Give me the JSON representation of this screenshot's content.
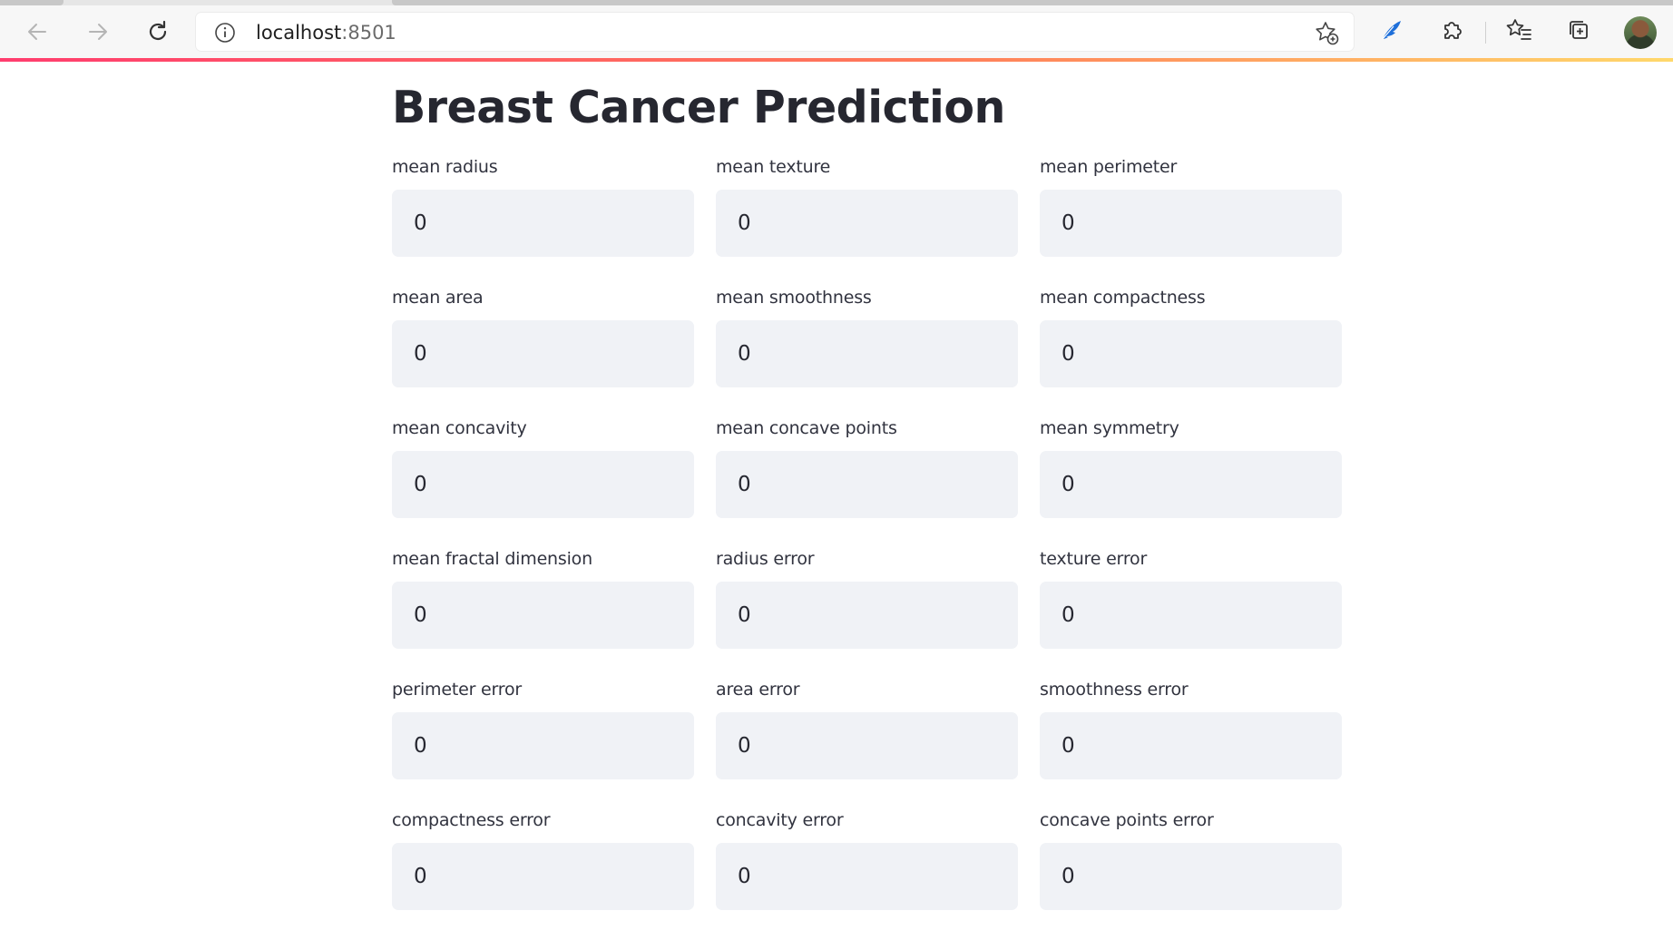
{
  "browser": {
    "url_host": "localhost",
    "url_port": ":8501",
    "icons": {
      "back": "arrow-left-icon",
      "forward": "arrow-right-icon",
      "reload": "reload-icon",
      "site_info": "info-icon",
      "add_favorite": "star-add-icon",
      "extension_1": "feather-extension-icon",
      "extensions": "puzzle-icon",
      "favorites": "favorites-list-icon",
      "collections": "collections-icon",
      "profile": "avatar"
    },
    "accent_gradient": [
      "#ff3d6e",
      "#ff7a59",
      "#ffd86b"
    ]
  },
  "app": {
    "title": "Breast Cancer Prediction",
    "fields": [
      {
        "label": "mean radius",
        "value": "0"
      },
      {
        "label": "mean texture",
        "value": "0"
      },
      {
        "label": "mean perimeter",
        "value": "0"
      },
      {
        "label": "mean area",
        "value": "0"
      },
      {
        "label": "mean smoothness",
        "value": "0"
      },
      {
        "label": "mean compactness",
        "value": "0"
      },
      {
        "label": "mean concavity",
        "value": "0"
      },
      {
        "label": "mean concave points",
        "value": "0"
      },
      {
        "label": "mean symmetry",
        "value": "0"
      },
      {
        "label": "mean fractal dimension",
        "value": "0"
      },
      {
        "label": "radius error",
        "value": "0"
      },
      {
        "label": "texture error",
        "value": "0"
      },
      {
        "label": "perimeter error",
        "value": "0"
      },
      {
        "label": "area error",
        "value": "0"
      },
      {
        "label": "smoothness error",
        "value": "0"
      },
      {
        "label": "compactness error",
        "value": "0"
      },
      {
        "label": "concavity error",
        "value": "0"
      },
      {
        "label": "concave points error",
        "value": "0"
      }
    ],
    "colors": {
      "input_background": "#f0f2f6",
      "title_text": "#262730",
      "label_text": "#31333f"
    }
  }
}
